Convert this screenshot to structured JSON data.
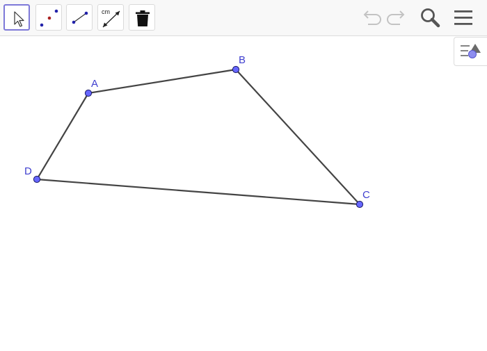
{
  "toolbar": {
    "tools": [
      {
        "name": "move-tool",
        "icon": "arrow-cursor-icon"
      },
      {
        "name": "point-tool",
        "icon": "points-icon"
      },
      {
        "name": "segment-tool",
        "icon": "segment-icon"
      },
      {
        "name": "distance-tool",
        "icon": "distance-icon",
        "icon_text": "cm"
      },
      {
        "name": "delete-tool",
        "icon": "trash-icon"
      }
    ],
    "right": [
      "undo-icon",
      "redo-icon",
      "search-icon",
      "menu-icon"
    ]
  },
  "graphics": {
    "points": [
      {
        "label": "A"
      },
      {
        "label": "B"
      },
      {
        "label": "C"
      },
      {
        "label": "D"
      }
    ]
  },
  "colors": {
    "point_fill": "#6666ff",
    "label": "#3f3fcf",
    "segment": "#444444",
    "selected_border": "#7d78d8"
  }
}
